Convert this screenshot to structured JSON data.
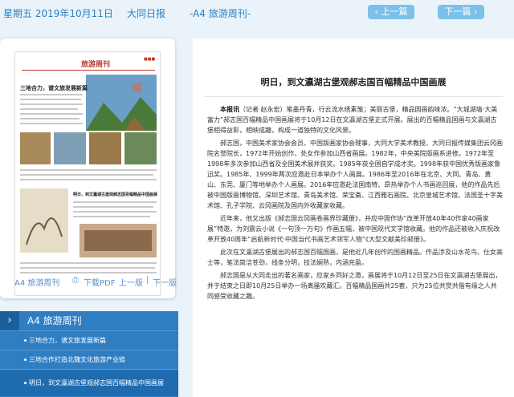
{
  "topbar": {
    "date": "星期五 2019年10月11日",
    "paper_name": "大同日报",
    "page_name": "-A4 旅游周刊-",
    "prev_label": "上一篇",
    "next_label": "下一篇",
    "accent": "#7cc0ea"
  },
  "preview": {
    "masthead": "旅游周刊",
    "headline_top": "三地合力，谱文旅发展新篇",
    "headline_mid": "明日，到文瀛湖古堡观郝志国百幅精品中国画展",
    "footer": {
      "page_link": "A4 旅游周刊",
      "pdf_link": "下载PDF",
      "prev_page": "上一版",
      "separator": "|",
      "next_page": "下一版"
    }
  },
  "article": {
    "title": "明日，到文瀛湖古堡观郝志国百幅精品中国画展",
    "lead_label": "本报讯",
    "lead_rest": "（记者 赵永宏）笔墨丹青，行云流水绣素笺；美丽古堡，精品国画韵味浓。“大城湖墙·大美富力”郝志国百幅精品中国画展将于10月12日在文瀛湖古堡正式开展。展出的百幅精品国画与文瀛湖古堡相得益彰，相映成趣，构成一道独特的文化风景。",
    "paragraphs": [
      "郝志国，中国美术家协会会员、中国版画家协会理事，大同大学美术教授、大同日报传媒集团云冈画院名誉院长，1972年开始创作，处女作参加山西省画展。1982年，中央美院版画系进修。1972年至1998年多次参加山西省及全国美术展并获奖。1985年获全国自学成才奖。1998年获中国优秀版画家鲁迅奖。1985年、1999年两次应邀赴日本举办个人画展。1986年至2016年在北京、大同、青岛、黄山、东莞、厦门等地举办个人画展。2016年应邀赴法国南特、昂热举办个人书画巡回展，他的作品先后被中国版画博物馆、深圳艺术馆、青岛美术馆、荣宝斋、江西雅石画院、北京皇城艺术馆、法国圣十字美术馆、孔子学院、云冈画院及国内外收藏家收藏。",
      "近年来，他又出版《郝志国云冈画卷画界珍藏册》，并应中国作协“改革开放40年40作家40画家展”特邀，为刘震云小说《一句顶一万句》作画五幅，被中国现代文学馆收藏。他的作品还被收入庆祝改革开放40周年“启航新时代·中国当代书画艺术领军人物”《大型文献美珍邮册》。",
      "此次在文瀛湖古堡展出的郝志国百幅国画，是他近几年创作的国画精品。作品涉及山水花鸟、仕女高士等，笔法简洁苍劲，线条分明，技法娴熟，内涵充盈。",
      "郝志国是从大同走出的著名画家，应家乡同好之邀，画展将于10月12日至25日在文瀛湖古堡展出，并于结束之日即10月25日举办一场离骚欢藏汇。百幅精品国画共25套，只为25位共赏共偕有缘之人共同感受收藏之趣。"
    ]
  },
  "sidebar": {
    "title": "A4 旅游周刊",
    "chevron": "›",
    "items": [
      "三地合力，谱文旅发展新篇",
      "三地合作打造北魏文化旅游产业链",
      "明日，到文瀛湖古堡观郝志国百幅精品中国画展"
    ],
    "active_index": 2
  }
}
